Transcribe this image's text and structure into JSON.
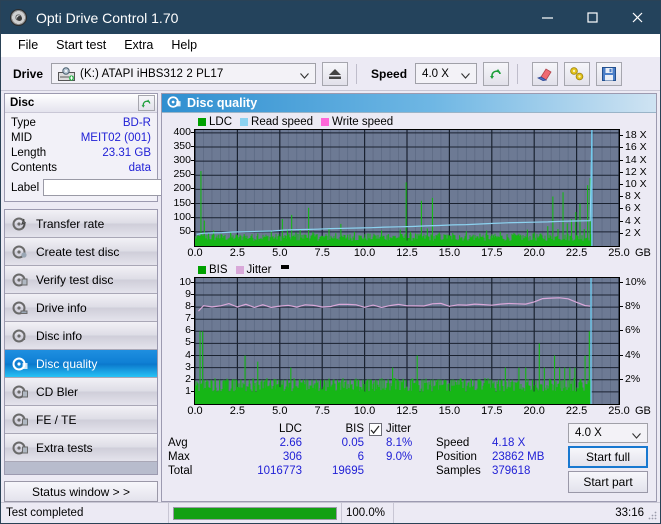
{
  "window": {
    "title": "Opti Drive Control 1.70",
    "app_icon": "disc-icon",
    "minimize": "minimize-icon",
    "maximize": "maximize-icon",
    "close": "close-icon"
  },
  "menu": {
    "items": [
      "File",
      "Start test",
      "Extra",
      "Help"
    ]
  },
  "toolbar": {
    "drive_label": "Drive",
    "drive_value": "(K:)  ATAPI iHBS312  2 PL17",
    "eject_icon": "eject-icon",
    "speed_label": "Speed",
    "speed_value": "4.0 X",
    "refresh_icon": "refresh-icon",
    "erase_icon": "eraser-icon",
    "tools_icon": "tools-icon",
    "save_icon": "save-icon"
  },
  "disc": {
    "header": "Disc",
    "refresh_icon": "refresh-icon",
    "rows": [
      {
        "key": "Type",
        "value": "BD-R"
      },
      {
        "key": "MID",
        "value": "MEIT02 (001)"
      },
      {
        "key": "Length",
        "value": "23.31 GB"
      },
      {
        "key": "Contents",
        "value": "data"
      }
    ],
    "label_key": "Label",
    "label_value": "",
    "label_placeholder": "",
    "label_button_icon": "disc-label-icon"
  },
  "nav": {
    "items": [
      {
        "label": "Transfer rate",
        "icon": "disc-transfer-icon",
        "selected": false
      },
      {
        "label": "Create test disc",
        "icon": "disc-create-icon",
        "selected": false
      },
      {
        "label": "Verify test disc",
        "icon": "disc-verify-icon",
        "selected": false
      },
      {
        "label": "Drive info",
        "icon": "disc-drive-icon",
        "selected": false
      },
      {
        "label": "Disc info",
        "icon": "disc-info-icon",
        "selected": false
      },
      {
        "label": "Disc quality",
        "icon": "disc-quality-icon",
        "selected": true
      },
      {
        "label": "CD Bler",
        "icon": "disc-bler-icon",
        "selected": false
      },
      {
        "label": "FE / TE",
        "icon": "disc-fete-icon",
        "selected": false
      },
      {
        "label": "Extra tests",
        "icon": "disc-extra-icon",
        "selected": false
      }
    ],
    "status_window": "Status window > >"
  },
  "panel": {
    "title": "Disc quality",
    "icon": "disc-quality-icon"
  },
  "stats": {
    "col_headers": [
      "LDC",
      "BIS"
    ],
    "row_labels": [
      "Avg",
      "Max",
      "Total"
    ],
    "ldc": {
      "avg": "2.66",
      "max": "306",
      "total": "1016773"
    },
    "bis": {
      "avg": "0.05",
      "max": "6",
      "total": "19695"
    },
    "jitter_checkbox_checked": true,
    "jitter_label": "Jitter",
    "jitter_avg": "8.1%",
    "jitter_max": "9.0%",
    "speed_key": "Speed",
    "speed_value": "4.18 X",
    "position_key": "Position",
    "position_value": "23862 MB",
    "samples_key": "Samples",
    "samples_value": "379618",
    "speed_select": "4.0 X",
    "start_full": "Start full",
    "start_part": "Start part"
  },
  "statusbar": {
    "text": "Test completed",
    "progress_pct": "100.0%",
    "progress_value": 100,
    "elapsed": "33:16"
  },
  "colors": {
    "ldc_green": "#16b616",
    "read_speed_blue": "#8cd2f0",
    "write_speed_pink": "#ff66d8",
    "bis_green": "#16b616",
    "jitter_pink": "#d9a8d9",
    "plot_bg": "#6d7a94",
    "accent_blue": "#2121d6"
  },
  "chart_data": [
    {
      "type": "line",
      "title": "LDC / Read speed",
      "legend": [
        {
          "label": "LDC",
          "color": "#00a000"
        },
        {
          "label": "Read speed",
          "color": "#8cd2f0"
        },
        {
          "label": "Write speed",
          "color": "#ff66d8"
        }
      ],
      "xlabel": "GB",
      "x_ticks": [
        "0.0",
        "2.5",
        "5.0",
        "7.5",
        "10.0",
        "12.5",
        "15.0",
        "17.5",
        "20.0",
        "22.5",
        "25.0"
      ],
      "xlim": [
        0,
        25
      ],
      "ylabel_left": "LDC",
      "y_ticks_left": [
        50,
        100,
        150,
        200,
        250,
        300,
        350,
        400
      ],
      "ylim_left": [
        0,
        410
      ],
      "ylabel_right": "Speed",
      "y_ticks_right": [
        "2 X",
        "4 X",
        "6 X",
        "8 X",
        "10 X",
        "12 X",
        "14 X",
        "16 X",
        "18 X"
      ],
      "ylim_right": [
        0,
        19
      ],
      "grid": true,
      "series": [
        {
          "name": "Read speed",
          "color": "#8cd2f0",
          "unit": "X",
          "x": [
            0.1,
            0.5,
            1.0,
            1.6,
            2.2,
            3.0,
            3.8,
            4.6,
            5.2,
            5.6,
            6.4,
            7.2,
            8.0,
            8.8,
            9.6,
            10.4,
            11.2,
            12.0,
            12.8,
            13.6,
            14.4,
            15.2,
            16.0,
            16.8,
            17.6,
            18.4,
            19.2,
            20.0,
            20.8,
            21.6,
            22.4,
            23.3,
            23.4
          ],
          "y": [
            1.9,
            2.1,
            2.15,
            2.2,
            2.3,
            2.35,
            2.4,
            2.45,
            2.6,
            2.65,
            2.7,
            2.75,
            2.85,
            2.9,
            2.95,
            3.0,
            3.1,
            3.15,
            3.2,
            3.3,
            3.35,
            3.45,
            3.5,
            3.6,
            3.7,
            3.8,
            3.85,
            3.9,
            3.95,
            4.05,
            4.1,
            4.15,
            18.5
          ]
        },
        {
          "name": "LDC",
          "color": "#16b616",
          "note": "dense green spike histogram along baseline, peaks to 306",
          "baseline": 18,
          "spikes": [
            [
              0.35,
              265
            ],
            [
              0.55,
              90
            ],
            [
              0.8,
              45
            ],
            [
              1.1,
              55
            ],
            [
              1.4,
              40
            ],
            [
              1.7,
              35
            ],
            [
              2.1,
              50
            ],
            [
              2.5,
              38
            ],
            [
              2.9,
              42
            ],
            [
              3.3,
              36
            ],
            [
              3.7,
              44
            ],
            [
              4.1,
              33
            ],
            [
              4.5,
              52
            ],
            [
              4.9,
              35
            ],
            [
              5.15,
              95
            ],
            [
              5.45,
              60
            ],
            [
              5.7,
              110
            ],
            [
              5.95,
              48
            ],
            [
              6.2,
              58
            ],
            [
              6.5,
              40
            ],
            [
              6.7,
              135
            ],
            [
              6.95,
              50
            ],
            [
              7.2,
              42
            ],
            [
              7.5,
              36
            ],
            [
              7.9,
              60
            ],
            [
              8.3,
              45
            ],
            [
              8.6,
              78
            ],
            [
              9.0,
              40
            ],
            [
              9.4,
              50
            ],
            [
              9.8,
              36
            ],
            [
              10.2,
              44
            ],
            [
              10.6,
              38
            ],
            [
              11.0,
              55
            ],
            [
              11.4,
              42
            ],
            [
              11.8,
              36
            ],
            [
              12.1,
              58
            ],
            [
              12.45,
              225
            ],
            [
              12.7,
              50
            ],
            [
              13.0,
              44
            ],
            [
              13.35,
              160
            ],
            [
              13.7,
              62
            ],
            [
              14.0,
              170
            ],
            [
              14.4,
              48
            ],
            [
              14.8,
              40
            ],
            [
              15.2,
              46
            ],
            [
              15.6,
              38
            ],
            [
              16.0,
              52
            ],
            [
              16.4,
              40
            ],
            [
              16.8,
              44
            ],
            [
              17.2,
              55
            ],
            [
              17.6,
              38
            ],
            [
              18.0,
              50
            ],
            [
              18.4,
              42
            ],
            [
              18.8,
              46
            ],
            [
              19.2,
              40
            ],
            [
              19.6,
              58
            ],
            [
              20.0,
              48
            ],
            [
              20.4,
              44
            ],
            [
              20.8,
              70
            ],
            [
              21.1,
              175
            ],
            [
              21.4,
              60
            ],
            [
              21.7,
              190
            ],
            [
              21.95,
              80
            ],
            [
              22.2,
              95
            ],
            [
              22.45,
              120
            ],
            [
              22.7,
              150
            ],
            [
              22.95,
              60
            ],
            [
              23.15,
              215
            ],
            [
              23.3,
              240
            ]
          ]
        }
      ]
    },
    {
      "type": "line",
      "title": "BIS / Jitter",
      "legend": [
        {
          "label": "BIS",
          "color": "#00a000"
        },
        {
          "label": "Jitter",
          "color": "#d9a8d9"
        }
      ],
      "xlabel": "GB",
      "x_ticks": [
        "0.0",
        "2.5",
        "5.0",
        "7.5",
        "10.0",
        "12.5",
        "15.0",
        "17.5",
        "20.0",
        "22.5",
        "25.0"
      ],
      "xlim": [
        0,
        25
      ],
      "ylabel_left": "BIS",
      "y_ticks_left": [
        1,
        2,
        3,
        4,
        5,
        6,
        7,
        8,
        9,
        10
      ],
      "ylim_left": [
        0,
        10.4
      ],
      "ylabel_right": "Jitter",
      "y_ticks_right": [
        "2%",
        "4%",
        "6%",
        "8%",
        "10%"
      ],
      "ylim_right": [
        0,
        10.4
      ],
      "grid": true,
      "series": [
        {
          "name": "Jitter",
          "color": "#d9a8d9",
          "unit": "%",
          "x": [
            0.2,
            0.5,
            1.0,
            1.5,
            2.0,
            2.5,
            3.0,
            3.5,
            4.0,
            4.5,
            5.0,
            5.5,
            6.0,
            6.5,
            7.0,
            7.5,
            8.0,
            8.5,
            9.0,
            9.5,
            10.0,
            10.5,
            11.0,
            11.5,
            12.0,
            12.5,
            13.0,
            13.5,
            14.0,
            14.5,
            15.0,
            15.5,
            16.0,
            16.5,
            17.0,
            17.5,
            18.0,
            18.5,
            19.0,
            19.5,
            20.0,
            20.5,
            21.0,
            21.5,
            22.0,
            22.5,
            23.0,
            23.3
          ],
          "y": [
            7.7,
            8.1,
            8.15,
            8.1,
            8.15,
            8.1,
            8.2,
            8.1,
            8.15,
            8.1,
            8.05,
            8.1,
            8.05,
            8.1,
            8.05,
            8.1,
            8.05,
            8.1,
            8.3,
            8.2,
            8.1,
            8.15,
            8.1,
            8.05,
            8.1,
            8.05,
            8.1,
            8.2,
            8.15,
            8.25,
            8.1,
            8.15,
            8.3,
            8.2,
            8.15,
            8.2,
            8.25,
            8.2,
            8.25,
            8.3,
            8.45,
            8.7,
            8.75,
            8.8,
            8.7,
            8.5,
            8.2,
            8.1
          ]
        },
        {
          "name": "BIS",
          "color": "#16b616",
          "note": "dense green spike histogram, baseline ~1, max 6",
          "baseline": 1,
          "spikes": [
            [
              0.3,
              6.0
            ],
            [
              0.45,
              6.0
            ],
            [
              0.7,
              2
            ],
            [
              0.95,
              2
            ],
            [
              1.2,
              2
            ],
            [
              1.45,
              2
            ],
            [
              1.7,
              2
            ],
            [
              1.95,
              2
            ],
            [
              2.2,
              2
            ],
            [
              2.45,
              2
            ],
            [
              2.7,
              2
            ],
            [
              2.95,
              4
            ],
            [
              3.2,
              2
            ],
            [
              3.45,
              2
            ],
            [
              3.7,
              3.5
            ],
            [
              3.95,
              2
            ],
            [
              4.2,
              2
            ],
            [
              4.45,
              2
            ],
            [
              4.7,
              2
            ],
            [
              4.95,
              2
            ],
            [
              5.2,
              2
            ],
            [
              5.45,
              2
            ],
            [
              5.65,
              3
            ],
            [
              5.9,
              2
            ],
            [
              6.15,
              2
            ],
            [
              6.4,
              2
            ],
            [
              6.65,
              2
            ],
            [
              6.9,
              2
            ],
            [
              7.15,
              2
            ],
            [
              7.4,
              2
            ],
            [
              7.65,
              2
            ],
            [
              7.9,
              2
            ],
            [
              8.15,
              2
            ],
            [
              8.4,
              2
            ],
            [
              8.65,
              2
            ],
            [
              8.9,
              2
            ],
            [
              9.15,
              2
            ],
            [
              9.4,
              2
            ],
            [
              9.65,
              2
            ],
            [
              9.9,
              2
            ],
            [
              10.15,
              2
            ],
            [
              10.4,
              2
            ],
            [
              10.65,
              2
            ],
            [
              10.9,
              2
            ],
            [
              11.15,
              2
            ],
            [
              11.4,
              2
            ],
            [
              11.65,
              3
            ],
            [
              11.9,
              2
            ],
            [
              12.3,
              2
            ],
            [
              12.7,
              2
            ],
            [
              13.1,
              4
            ],
            [
              13.5,
              2
            ],
            [
              13.9,
              2
            ],
            [
              14.3,
              2
            ],
            [
              14.7,
              2
            ],
            [
              15.1,
              2
            ],
            [
              15.5,
              2
            ],
            [
              15.9,
              2
            ],
            [
              16.3,
              2
            ],
            [
              16.7,
              2
            ],
            [
              17.1,
              2
            ],
            [
              17.5,
              2
            ],
            [
              17.9,
              2
            ],
            [
              18.3,
              3
            ],
            [
              18.7,
              2
            ],
            [
              19.1,
              3
            ],
            [
              19.5,
              3
            ],
            [
              19.9,
              2
            ],
            [
              20.3,
              5
            ],
            [
              20.6,
              3
            ],
            [
              20.9,
              2
            ],
            [
              21.2,
              4
            ],
            [
              21.5,
              3
            ],
            [
              21.8,
              3
            ],
            [
              22.1,
              3
            ],
            [
              22.4,
              3
            ],
            [
              22.7,
              2
            ],
            [
              23.0,
              4
            ],
            [
              23.25,
              6.0
            ]
          ]
        }
      ]
    }
  ]
}
